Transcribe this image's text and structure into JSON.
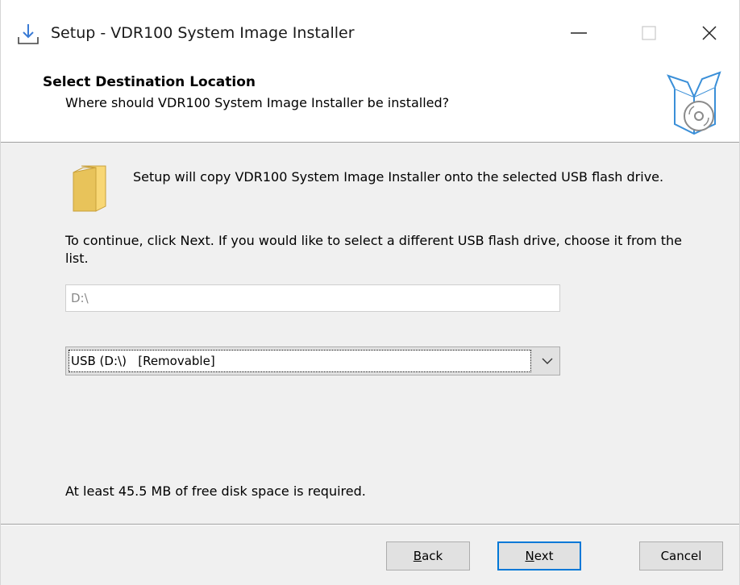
{
  "window": {
    "title": "Setup - VDR100 System Image Installer",
    "icons": {
      "app": "install-download-icon",
      "minimize": "minimize-icon",
      "maximize": "maximize-icon",
      "close": "close-icon"
    }
  },
  "header": {
    "title": "Select Destination Location",
    "subtitle": "Where should VDR100 System Image Installer be installed?",
    "art_icon": "box-with-disc-icon"
  },
  "body": {
    "folder_icon": "folder-icon",
    "intro": "Setup will copy VDR100 System Image Installer onto the selected USB flash drive.",
    "instructions": "To continue, click Next. If you would like to select a different USB flash drive, choose it from the list.",
    "path_value": "D:\\",
    "drive_select": {
      "selected": "USB (D:\\)   [Removable]",
      "arrow_icon": "chevron-down-icon"
    },
    "space_required": "At least 45.5 MB of free disk space is required."
  },
  "footer": {
    "back": {
      "accel": "B",
      "rest": "ack"
    },
    "next": {
      "accel": "N",
      "rest": "ext"
    },
    "cancel": "Cancel"
  },
  "colors": {
    "accent": "#0078d7",
    "dialog_bg": "#f0f0f0",
    "header_bg": "#ffffff",
    "folder": "#f8d775"
  }
}
